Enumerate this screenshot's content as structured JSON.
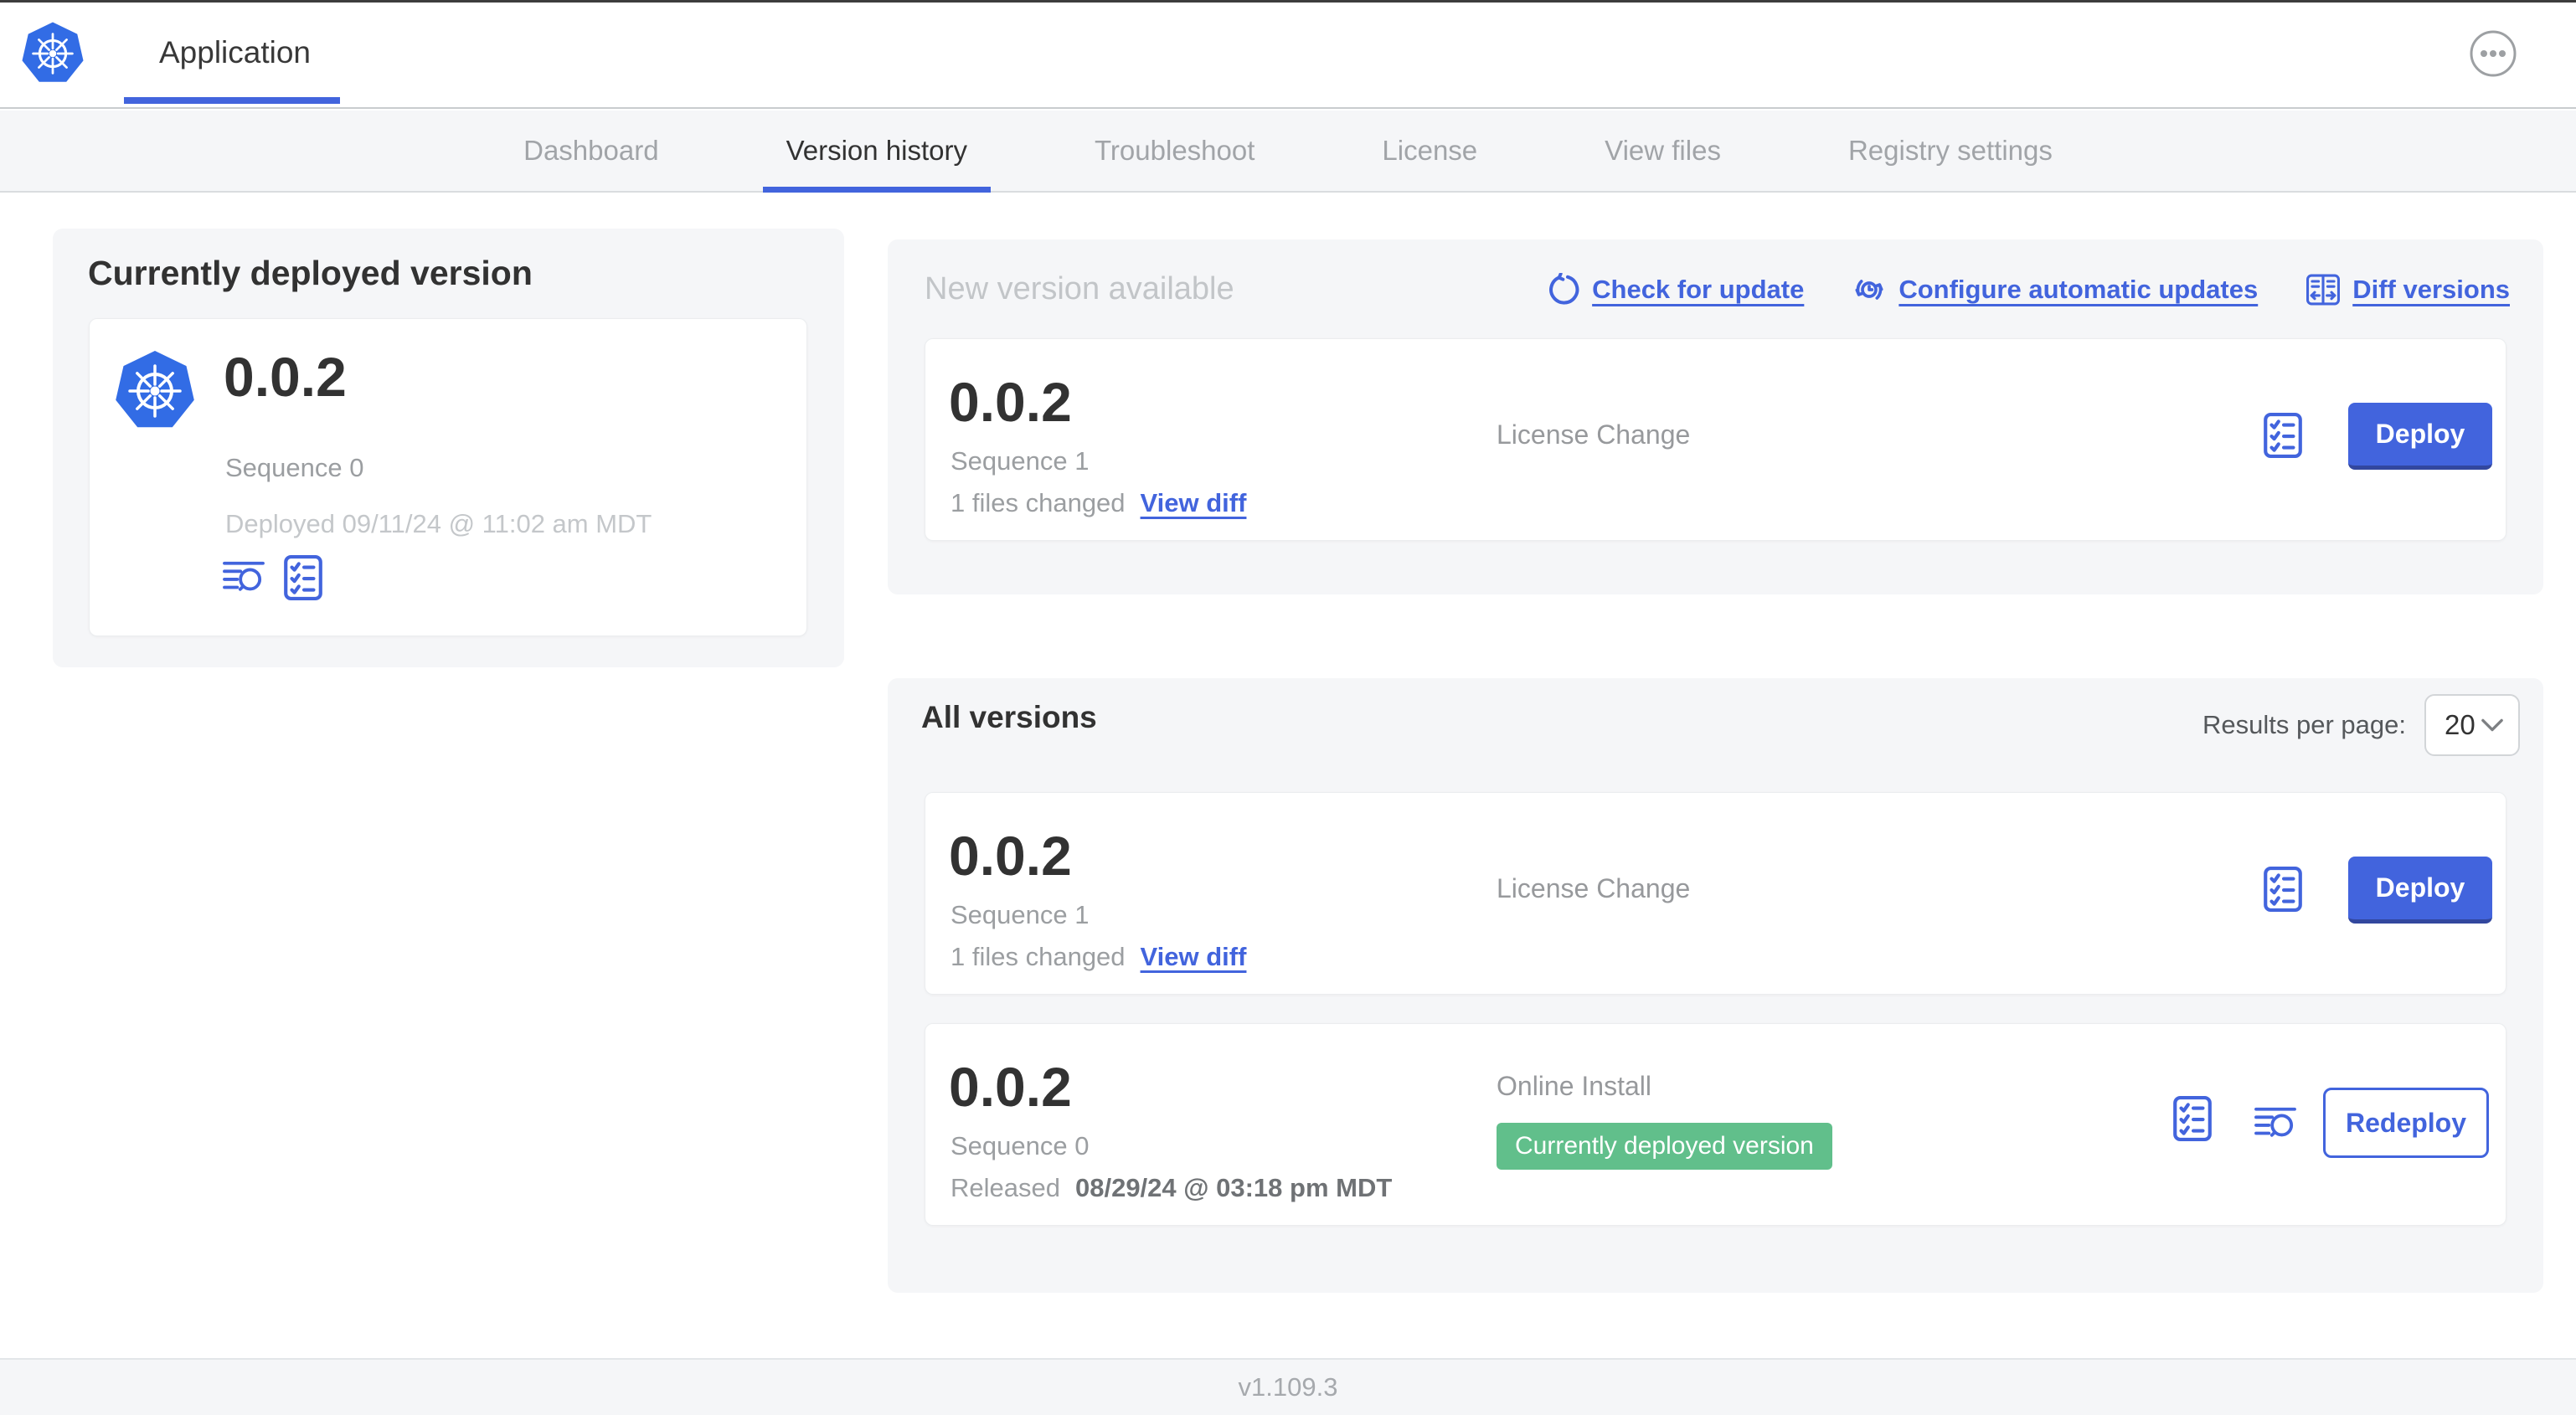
{
  "header": {
    "app_tab": "Application",
    "menu_icon": "ellipsis-icon"
  },
  "nav": {
    "tabs": [
      {
        "label": "Dashboard",
        "active": false
      },
      {
        "label": "Version history",
        "active": true
      },
      {
        "label": "Troubleshoot",
        "active": false
      },
      {
        "label": "License",
        "active": false
      },
      {
        "label": "View files",
        "active": false
      },
      {
        "label": "Registry settings",
        "active": false
      }
    ]
  },
  "current": {
    "title": "Currently deployed version",
    "version": "0.0.2",
    "sequence": "Sequence 0",
    "deployed": "Deployed 09/11/24 @ 11:02 am MDT",
    "icons": [
      "view-logs-icon",
      "preflight-checks-icon"
    ]
  },
  "newver": {
    "title": "New version available",
    "links": {
      "check": "Check for update",
      "configure": "Configure automatic updates",
      "diff": "Diff versions"
    },
    "card": {
      "version": "0.0.2",
      "sequence": "Sequence 1",
      "files_changed": "1 files changed",
      "view_diff": "View diff",
      "source": "License Change",
      "deploy": "Deploy"
    }
  },
  "allver": {
    "title": "All versions",
    "results_label": "Results per page:",
    "per_page": "20",
    "rows": [
      {
        "version": "0.0.2",
        "sequence": "Sequence 1",
        "files_changed": "1 files changed",
        "view_diff": "View diff",
        "source": "License Change",
        "action": "Deploy"
      },
      {
        "version": "0.0.2",
        "sequence": "Sequence 0",
        "released_prefix": "Released",
        "released_date": "08/29/24 @ 03:18 pm MDT",
        "source": "Online Install",
        "badge": "Currently deployed version",
        "action": "Redeploy"
      }
    ]
  },
  "footer": {
    "version": "v1.109.3"
  },
  "colors": {
    "accent_blue": "#4264dd",
    "kubernetes_blue": "#326ce5",
    "badge_green": "#61bf8b",
    "panel_bg": "#f5f6f8",
    "text_dark": "#323232",
    "text_gray": "#9b9ea1",
    "text_light_gray": "#c4c7ca"
  }
}
